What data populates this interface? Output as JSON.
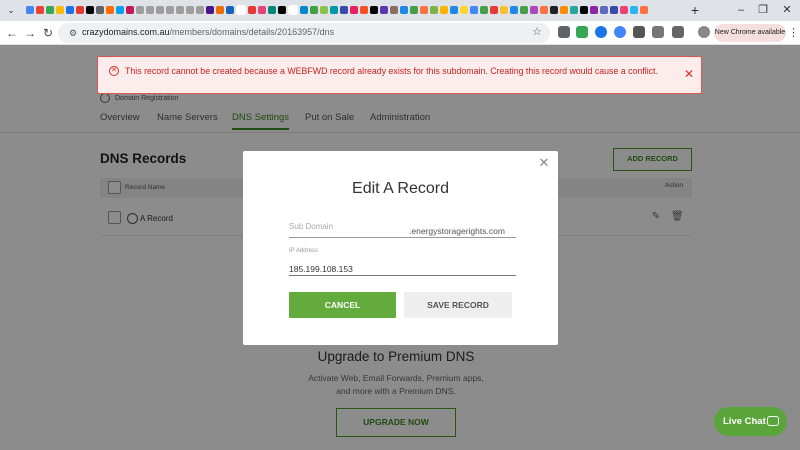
{
  "browser": {
    "url_host": "crazydomains.com.au",
    "url_path": "/members/domains/details/20163957/dns",
    "new_chrome_label": "New Chrome available",
    "tab_favicon_colors": [
      "#4285f4",
      "#ea4335",
      "#34a853",
      "#fbbc04",
      "#1a73e8",
      "#e53935",
      "#000000",
      "#5f6368",
      "#ff6d00",
      "#00a1f1",
      "#c2185b",
      "#9e9e9e",
      "#9e9e9e",
      "#9e9e9e",
      "#9e9e9e",
      "#9e9e9e",
      "#9e9e9e",
      "#9e9e9e",
      "#4a148c",
      "#ef6c00",
      "#1565c0",
      "#ffffff",
      "#e53935",
      "#ec407a",
      "#00897b",
      "#000000",
      "#ffffff",
      "#0288d1",
      "#43a047",
      "#8bc34a",
      "#0097a7",
      "#3949ab",
      "#e91e63",
      "#f4511e",
      "#000000",
      "#5e35b1",
      "#8d6e63",
      "#1e88e5",
      "#43a047",
      "#ff7043",
      "#7cb342",
      "#ffb300",
      "#1e88e5",
      "#fdd835",
      "#4285f4",
      "#43a047",
      "#e53935",
      "#fbc02d",
      "#1e88e5",
      "#43a047",
      "#ab47bc",
      "#ff7043",
      "#212121",
      "#fb8c00",
      "#26a69a",
      "#000000",
      "#8e24aa",
      "#5c6bc0",
      "#3949ab",
      "#ec407a",
      "#29b6f6",
      "#ff7043"
    ]
  },
  "page": {
    "domain_registration": "Domain Registration",
    "tabs": [
      {
        "label": "Overview",
        "active": false
      },
      {
        "label": "Name Servers",
        "active": false
      },
      {
        "label": "DNS Settings",
        "active": true
      },
      {
        "label": "Put on Sale",
        "active": false
      },
      {
        "label": "Administration",
        "active": false
      }
    ],
    "dns_title": "DNS Records",
    "add_record": "ADD RECORD",
    "table": {
      "col_name": "Record Name",
      "col_action": "Action",
      "rows": [
        {
          "label": "A Record"
        }
      ]
    },
    "premium": {
      "title": "Upgrade to Premium DNS",
      "desc_line1": "Activate Web, Email Forwards, Premium apps,",
      "desc_line2": "and more with a Premium DNS.",
      "button": "UPGRADE NOW"
    }
  },
  "error": {
    "message": "This record cannot be created because a WEBFWD record already exists for this subdomain. Creating this record would cause a conflict.",
    "color": "#d93025"
  },
  "modal": {
    "title": "Edit A Record",
    "sub_domain_placeholder": "Sub Domain",
    "domain_suffix": ".energystoragerights.com",
    "ip_label": "IP Address",
    "ip_value": "185.199.108.153",
    "cancel": "CANCEL",
    "save": "SAVE RECORD"
  },
  "live_chat": "Live Chat",
  "colors": {
    "brand_green": "#63ab3c",
    "overlay": "rgba(0,0,0,0.45)"
  }
}
